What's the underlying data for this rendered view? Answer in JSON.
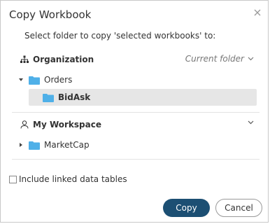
{
  "dialog": {
    "title": "Copy Workbook",
    "subtitle": "Select folder to copy 'selected workbooks' to:"
  },
  "organization": {
    "label": "Organization",
    "current_folder": "Current folder",
    "icon": "organization-icon",
    "items": [
      {
        "label": "Orders",
        "expanded": true
      },
      {
        "label": "BidAsk",
        "selected": true
      }
    ]
  },
  "workspace": {
    "label": "My Workspace",
    "icon": "user-icon",
    "items": [
      {
        "label": "MarketCap",
        "expanded": false
      }
    ]
  },
  "options": {
    "include_linked": "Include linked data tables",
    "include_linked_checked": false
  },
  "buttons": {
    "copy": "Copy",
    "cancel": "Cancel"
  },
  "colors": {
    "primary": "#1c4f73",
    "folder": "#4fb0e8",
    "selected_bg": "#e6e6e6"
  }
}
